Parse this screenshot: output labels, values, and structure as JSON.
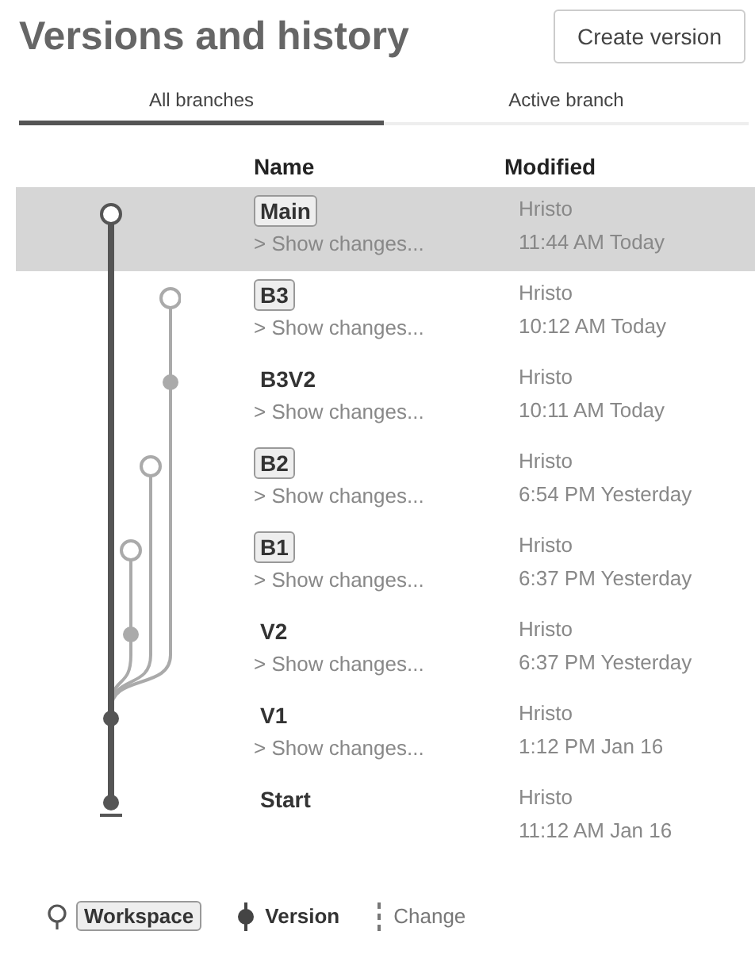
{
  "header": {
    "title": "Versions and history",
    "create_button": "Create version"
  },
  "tabs": [
    {
      "label": "All branches",
      "selected": true
    },
    {
      "label": "Active branch",
      "selected": false
    }
  ],
  "columns": [
    "Name",
    "Modified"
  ],
  "rows": [
    {
      "name": "Main",
      "kind": "workspace",
      "main": true,
      "selected": true,
      "changes": "> Show changes...",
      "author": "Hristo",
      "time": "11:44 AM Today"
    },
    {
      "name": "B3",
      "kind": "workspace",
      "main": false,
      "selected": false,
      "changes": "> Show changes...",
      "author": "Hristo",
      "time": "10:12 AM Today"
    },
    {
      "name": "B3V2",
      "kind": "version",
      "main": false,
      "selected": false,
      "changes": "> Show changes...",
      "author": "Hristo",
      "time": "10:11 AM Today"
    },
    {
      "name": "B2",
      "kind": "workspace",
      "main": false,
      "selected": false,
      "changes": "> Show changes...",
      "author": "Hristo",
      "time": "6:54 PM Yesterday"
    },
    {
      "name": "B1",
      "kind": "workspace",
      "main": false,
      "selected": false,
      "changes": "> Show changes...",
      "author": "Hristo",
      "time": "6:37 PM Yesterday"
    },
    {
      "name": "V2",
      "kind": "version",
      "main": false,
      "selected": false,
      "changes": "> Show changes...",
      "author": "Hristo",
      "time": "6:37 PM Yesterday"
    },
    {
      "name": "V1",
      "kind": "version",
      "main": true,
      "selected": false,
      "changes": "> Show changes...",
      "author": "Hristo",
      "time": "1:12 PM Jan 16"
    },
    {
      "name": "Start",
      "kind": "start",
      "main": true,
      "selected": false,
      "author": "Hristo",
      "time": "11:12 AM Jan 16"
    }
  ],
  "legend": [
    {
      "kind": "workspace",
      "label": "Workspace"
    },
    {
      "kind": "version",
      "label": "Version"
    },
    {
      "kind": "change",
      "label": "Change"
    }
  ]
}
